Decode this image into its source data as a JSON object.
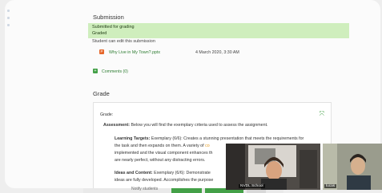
{
  "submission": {
    "title": "Submission",
    "status_submitted": "Submitted for grading",
    "status_graded": "Graded",
    "edit_note": "Student can edit this submission",
    "file_name": "Why Live in My Town?.pptx",
    "file_date": "4 March 2020, 3:30 AM",
    "comments_label": "Comments (0)"
  },
  "grade": {
    "section_title": "Grade",
    "field_label": "Grade:",
    "assessment_lead": "Assessment:",
    "assessment_text": "Below you will find the exemplary criteria used to assess the assignment.",
    "learning_title": "Learning Targets:",
    "learning_line1": "Exemplary (6/6): Creates a stunning presentation that meets the requirements for",
    "learning_line2a": "the task and then expands on them. A variety of",
    "learning_line2b": "co",
    "learning_line3": "implemented and the visual component enhances th",
    "learning_line4": "are nearly perfect, without any distracting errors.",
    "ideas_title": "Ideas and Content:",
    "ideas_line1": "Exemplary (6/6): Demonstrate",
    "ideas_line2": "ideas are fully developed. Accomplishes the purpose"
  },
  "video": {
    "person1": "NVDL School",
    "person2": "lucas"
  },
  "bottom": {
    "partial_text": "Notify students"
  },
  "colors": {
    "status_green": "#cfeebd",
    "link_green": "#2e7d32",
    "accent_orange": "#e5662a"
  }
}
